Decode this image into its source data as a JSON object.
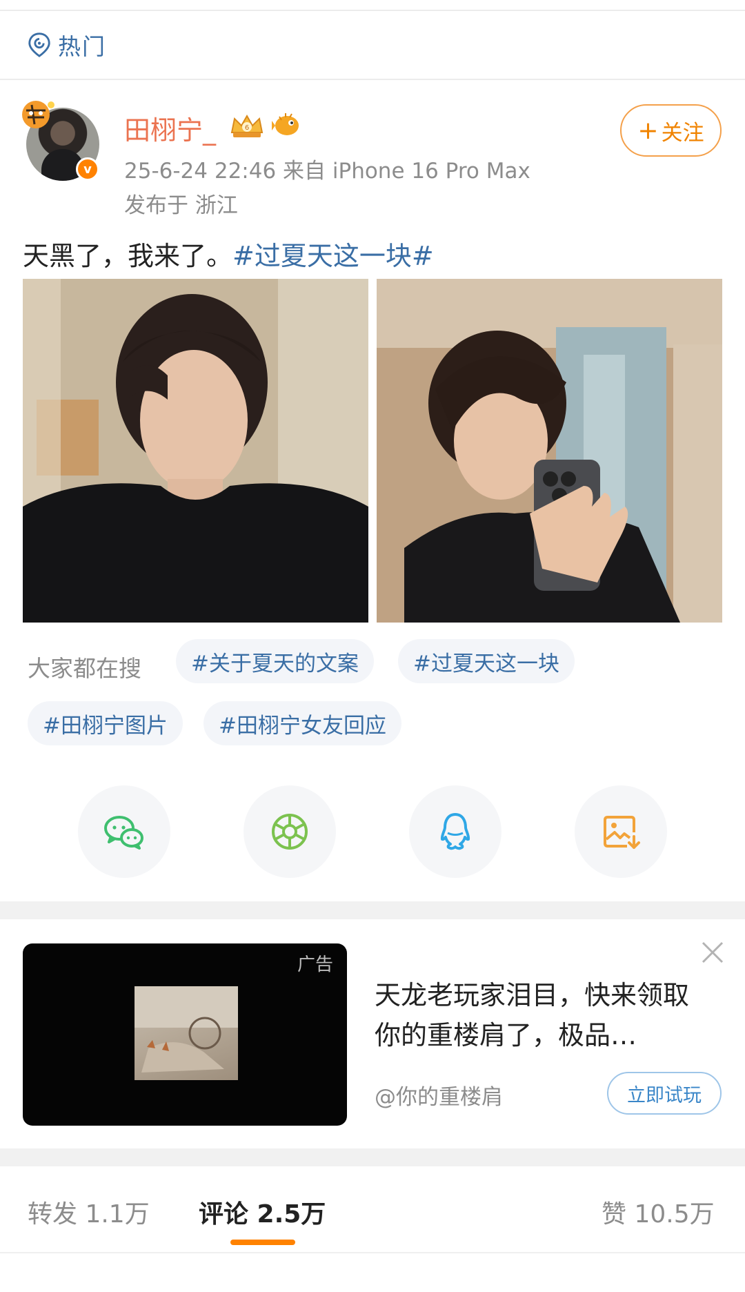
{
  "header": {
    "section_label": "热门",
    "icon": "location-pin-icon"
  },
  "post": {
    "username": "田栩宁_",
    "meta": "25-6-24 22:46   来自 iPhone 16 Pro Max",
    "location": "发布于 浙江",
    "text": "天黑了，我来了。",
    "hashtag": "#过夏天这一块#",
    "follow_label": "关注",
    "follow_plus": "+"
  },
  "search": {
    "label": "大家都在搜",
    "tags": [
      "#关于夏天的文案",
      "#过夏天这一块",
      "#田栩宁图片",
      "#田栩宁女友回应"
    ]
  },
  "share": [
    {
      "icon": "wechat-icon",
      "color": "#3fbf6f"
    },
    {
      "icon": "moments-icon",
      "color": "#7cc24f"
    },
    {
      "icon": "qq-icon",
      "color": "#2fa7e6"
    },
    {
      "icon": "save-image-icon",
      "color": "#f2a33a"
    }
  ],
  "ad": {
    "tag": "广告",
    "title": "天龙老玩家泪目，快来领取你的重楼肩了，极品…",
    "source": "@你的重楼肩",
    "cta": "立即试玩"
  },
  "stats": {
    "repost": "转发 1.1万",
    "comment": "评论 2.5万",
    "like": "赞 10.5万"
  },
  "colors": {
    "accent": "#ff8200",
    "link": "#3a6ea5",
    "username": "#eb7350"
  }
}
